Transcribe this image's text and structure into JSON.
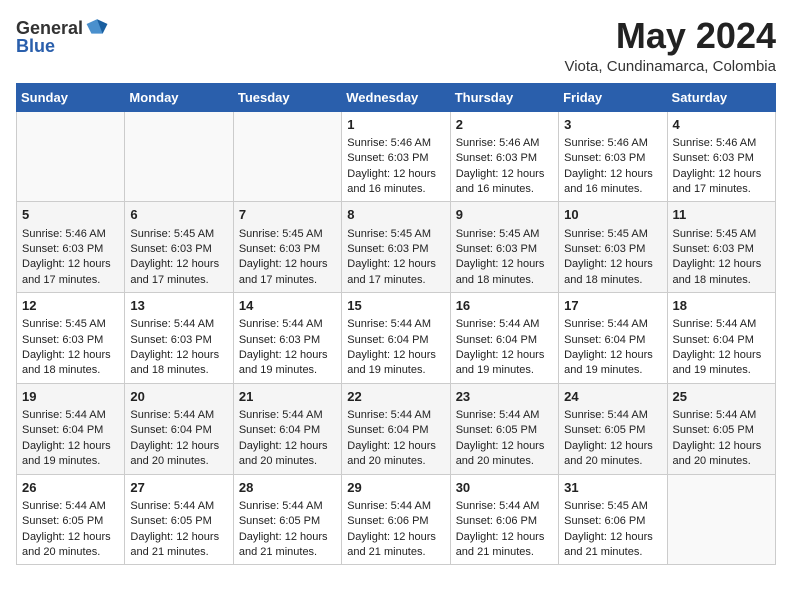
{
  "header": {
    "logo_general": "General",
    "logo_blue": "Blue",
    "month_year": "May 2024",
    "location": "Viota, Cundinamarca, Colombia"
  },
  "days_of_week": [
    "Sunday",
    "Monday",
    "Tuesday",
    "Wednesday",
    "Thursday",
    "Friday",
    "Saturday"
  ],
  "weeks": [
    [
      {
        "day": "",
        "content": ""
      },
      {
        "day": "",
        "content": ""
      },
      {
        "day": "",
        "content": ""
      },
      {
        "day": "1",
        "content": "Sunrise: 5:46 AM\nSunset: 6:03 PM\nDaylight: 12 hours\nand 16 minutes."
      },
      {
        "day": "2",
        "content": "Sunrise: 5:46 AM\nSunset: 6:03 PM\nDaylight: 12 hours\nand 16 minutes."
      },
      {
        "day": "3",
        "content": "Sunrise: 5:46 AM\nSunset: 6:03 PM\nDaylight: 12 hours\nand 16 minutes."
      },
      {
        "day": "4",
        "content": "Sunrise: 5:46 AM\nSunset: 6:03 PM\nDaylight: 12 hours\nand 17 minutes."
      }
    ],
    [
      {
        "day": "5",
        "content": "Sunrise: 5:46 AM\nSunset: 6:03 PM\nDaylight: 12 hours\nand 17 minutes."
      },
      {
        "day": "6",
        "content": "Sunrise: 5:45 AM\nSunset: 6:03 PM\nDaylight: 12 hours\nand 17 minutes."
      },
      {
        "day": "7",
        "content": "Sunrise: 5:45 AM\nSunset: 6:03 PM\nDaylight: 12 hours\nand 17 minutes."
      },
      {
        "day": "8",
        "content": "Sunrise: 5:45 AM\nSunset: 6:03 PM\nDaylight: 12 hours\nand 17 minutes."
      },
      {
        "day": "9",
        "content": "Sunrise: 5:45 AM\nSunset: 6:03 PM\nDaylight: 12 hours\nand 18 minutes."
      },
      {
        "day": "10",
        "content": "Sunrise: 5:45 AM\nSunset: 6:03 PM\nDaylight: 12 hours\nand 18 minutes."
      },
      {
        "day": "11",
        "content": "Sunrise: 5:45 AM\nSunset: 6:03 PM\nDaylight: 12 hours\nand 18 minutes."
      }
    ],
    [
      {
        "day": "12",
        "content": "Sunrise: 5:45 AM\nSunset: 6:03 PM\nDaylight: 12 hours\nand 18 minutes."
      },
      {
        "day": "13",
        "content": "Sunrise: 5:44 AM\nSunset: 6:03 PM\nDaylight: 12 hours\nand 18 minutes."
      },
      {
        "day": "14",
        "content": "Sunrise: 5:44 AM\nSunset: 6:03 PM\nDaylight: 12 hours\nand 19 minutes."
      },
      {
        "day": "15",
        "content": "Sunrise: 5:44 AM\nSunset: 6:04 PM\nDaylight: 12 hours\nand 19 minutes."
      },
      {
        "day": "16",
        "content": "Sunrise: 5:44 AM\nSunset: 6:04 PM\nDaylight: 12 hours\nand 19 minutes."
      },
      {
        "day": "17",
        "content": "Sunrise: 5:44 AM\nSunset: 6:04 PM\nDaylight: 12 hours\nand 19 minutes."
      },
      {
        "day": "18",
        "content": "Sunrise: 5:44 AM\nSunset: 6:04 PM\nDaylight: 12 hours\nand 19 minutes."
      }
    ],
    [
      {
        "day": "19",
        "content": "Sunrise: 5:44 AM\nSunset: 6:04 PM\nDaylight: 12 hours\nand 19 minutes."
      },
      {
        "day": "20",
        "content": "Sunrise: 5:44 AM\nSunset: 6:04 PM\nDaylight: 12 hours\nand 20 minutes."
      },
      {
        "day": "21",
        "content": "Sunrise: 5:44 AM\nSunset: 6:04 PM\nDaylight: 12 hours\nand 20 minutes."
      },
      {
        "day": "22",
        "content": "Sunrise: 5:44 AM\nSunset: 6:04 PM\nDaylight: 12 hours\nand 20 minutes."
      },
      {
        "day": "23",
        "content": "Sunrise: 5:44 AM\nSunset: 6:05 PM\nDaylight: 12 hours\nand 20 minutes."
      },
      {
        "day": "24",
        "content": "Sunrise: 5:44 AM\nSunset: 6:05 PM\nDaylight: 12 hours\nand 20 minutes."
      },
      {
        "day": "25",
        "content": "Sunrise: 5:44 AM\nSunset: 6:05 PM\nDaylight: 12 hours\nand 20 minutes."
      }
    ],
    [
      {
        "day": "26",
        "content": "Sunrise: 5:44 AM\nSunset: 6:05 PM\nDaylight: 12 hours\nand 20 minutes."
      },
      {
        "day": "27",
        "content": "Sunrise: 5:44 AM\nSunset: 6:05 PM\nDaylight: 12 hours\nand 21 minutes."
      },
      {
        "day": "28",
        "content": "Sunrise: 5:44 AM\nSunset: 6:05 PM\nDaylight: 12 hours\nand 21 minutes."
      },
      {
        "day": "29",
        "content": "Sunrise: 5:44 AM\nSunset: 6:06 PM\nDaylight: 12 hours\nand 21 minutes."
      },
      {
        "day": "30",
        "content": "Sunrise: 5:44 AM\nSunset: 6:06 PM\nDaylight: 12 hours\nand 21 minutes."
      },
      {
        "day": "31",
        "content": "Sunrise: 5:45 AM\nSunset: 6:06 PM\nDaylight: 12 hours\nand 21 minutes."
      },
      {
        "day": "",
        "content": ""
      }
    ]
  ]
}
